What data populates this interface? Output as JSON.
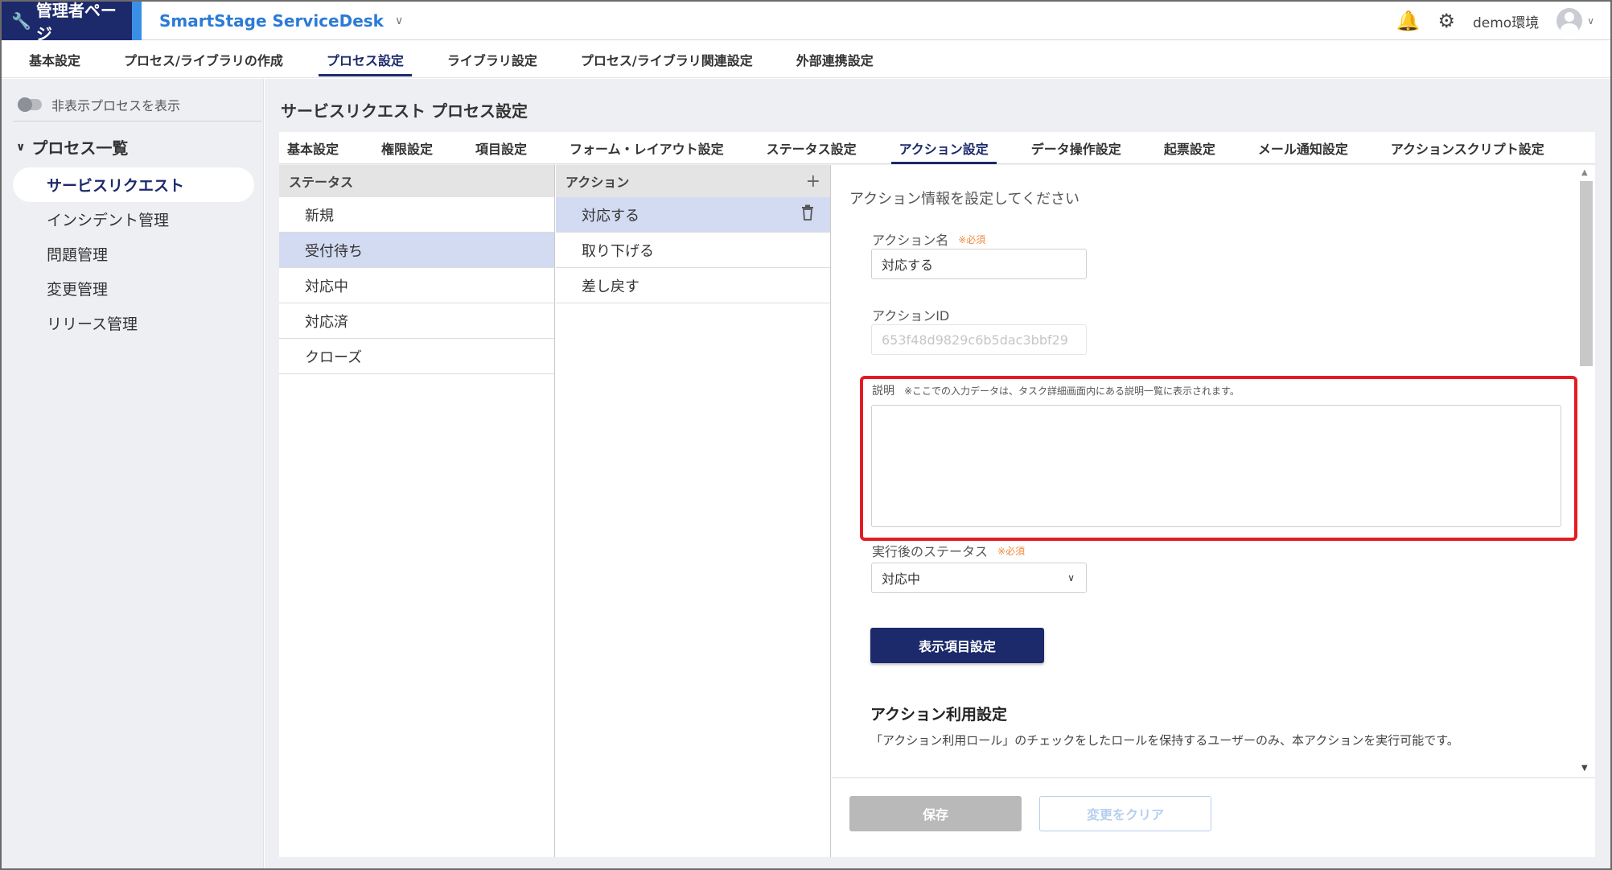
{
  "header": {
    "admin_label": "管理者ページ",
    "app_name": "SmartStage ServiceDesk",
    "env_label": "demo環境",
    "bell_icon": "bell-icon",
    "settings_icon": "gear-icon"
  },
  "main_nav": [
    {
      "label": "基本設定"
    },
    {
      "label": "プロセス/ライブラリの作成"
    },
    {
      "label": "プロセス設定",
      "active": true
    },
    {
      "label": "ライブラリ設定"
    },
    {
      "label": "プロセス/ライブラリ関連設定"
    },
    {
      "label": "外部連携設定"
    }
  ],
  "sidebar": {
    "toggle_label": "非表示プロセスを表示",
    "section_title": "プロセス一覧",
    "items": [
      {
        "label": "サービスリクエスト",
        "active": true
      },
      {
        "label": "インシデント管理"
      },
      {
        "label": "問題管理"
      },
      {
        "label": "変更管理"
      },
      {
        "label": "リリース管理"
      }
    ]
  },
  "content": {
    "page_title": "サービスリクエスト プロセス設定",
    "sub_tabs": [
      {
        "label": "基本設定"
      },
      {
        "label": "権限設定"
      },
      {
        "label": "項目設定"
      },
      {
        "label": "フォーム・レイアウト設定"
      },
      {
        "label": "ステータス設定"
      },
      {
        "label": "アクション設定",
        "active": true
      },
      {
        "label": "データ操作設定"
      },
      {
        "label": "起票設定"
      },
      {
        "label": "メール通知設定"
      },
      {
        "label": "アクションスクリプト設定"
      }
    ],
    "status_column": {
      "header": "ステータス",
      "rows": [
        {
          "label": "新規"
        },
        {
          "label": "受付待ち",
          "selected": true
        },
        {
          "label": "対応中"
        },
        {
          "label": "対応済"
        },
        {
          "label": "クローズ"
        }
      ]
    },
    "action_column": {
      "header": "アクション",
      "add_symbol": "+",
      "rows": [
        {
          "label": "対応する",
          "selected": true
        },
        {
          "label": "取り下げる"
        },
        {
          "label": "差し戻す"
        }
      ]
    },
    "detail": {
      "heading": "アクション情報を設定してください",
      "action_name_label": "アクション名",
      "required_mark": "※必須",
      "action_name_value": "対応する",
      "action_id_label": "アクションID",
      "action_id_value": "653f48d9829c6b5dac3bbf29",
      "description_label": "説明",
      "description_note": "※ここでの入力データは、タスク詳細画面内にある説明一覧に表示されます。",
      "description_value": "",
      "post_status_label": "実行後のステータス",
      "post_status_value": "対応中",
      "display_items_button": "表示項目設定",
      "usage_section_title": "アクション利用設定",
      "usage_section_desc": "「アクション利用ロール」のチェックをしたロールを保持するユーザーのみ、本アクションを実行可能です。"
    },
    "footer": {
      "save_label": "保存",
      "clear_label": "変更をクリア"
    }
  },
  "colors": {
    "brand_navy": "#1c2a6b",
    "brand_blue": "#2b7bd6",
    "highlight_red": "#e31b23",
    "required_orange": "#f08a3c",
    "selected_row": "#d3dbf2"
  }
}
